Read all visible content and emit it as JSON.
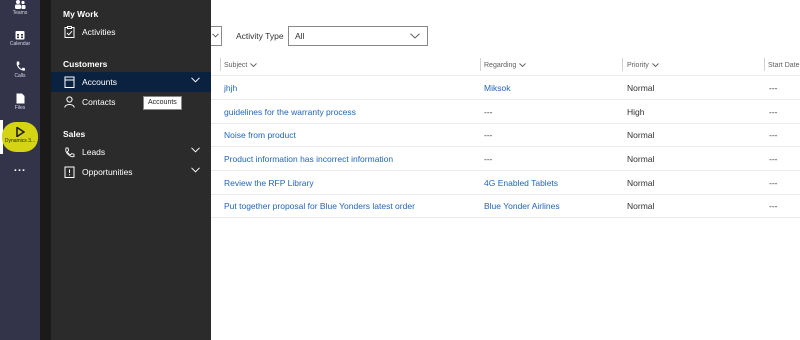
{
  "rail": {
    "items": [
      {
        "label": "Teams"
      },
      {
        "label": "Calendar"
      },
      {
        "label": "Calls"
      },
      {
        "label": "Files"
      },
      {
        "label": "Dynamics 3..."
      },
      {
        "label": "..."
      }
    ]
  },
  "sitemap": {
    "my_work": {
      "title": "My Work",
      "items": [
        {
          "label": "Activities"
        }
      ]
    },
    "customers": {
      "title": "Customers",
      "items": [
        {
          "label": "Accounts"
        },
        {
          "label": "Contacts"
        }
      ]
    },
    "sales": {
      "title": "Sales",
      "items": [
        {
          "label": "Leads"
        },
        {
          "label": "Opportunities"
        }
      ]
    },
    "tooltip": "Accounts"
  },
  "filter": {
    "label": "Activity Type",
    "value": "All"
  },
  "grid": {
    "columns": [
      "Subject",
      "Regarding",
      "Priority",
      "Start Date"
    ],
    "rows": [
      {
        "subject": "jhjh",
        "regarding": "Miksok",
        "regarding_link": true,
        "priority": "Normal",
        "start": "---"
      },
      {
        "subject": "guidelines for the warranty process",
        "regarding": "---",
        "regarding_link": false,
        "priority": "High",
        "start": "---"
      },
      {
        "subject": "Noise from product",
        "regarding": "---",
        "regarding_link": false,
        "priority": "Normal",
        "start": "---"
      },
      {
        "subject": "Product information has incorrect information",
        "regarding": "---",
        "regarding_link": false,
        "priority": "Normal",
        "start": "---"
      },
      {
        "subject": "Review the RFP Library",
        "regarding": "4G Enabled Tablets",
        "regarding_link": true,
        "priority": "Normal",
        "start": "---"
      },
      {
        "subject": "Put together proposal for Blue Yonders latest order",
        "regarding": "Blue Yonder Airlines",
        "regarding_link": true,
        "priority": "Normal",
        "start": "---"
      }
    ]
  },
  "colors": {
    "link": "#2266b8",
    "rail": "#33344a",
    "sitemap": "#2b2b2b",
    "selected": "#0b2140",
    "active_app": "#d4d414"
  }
}
